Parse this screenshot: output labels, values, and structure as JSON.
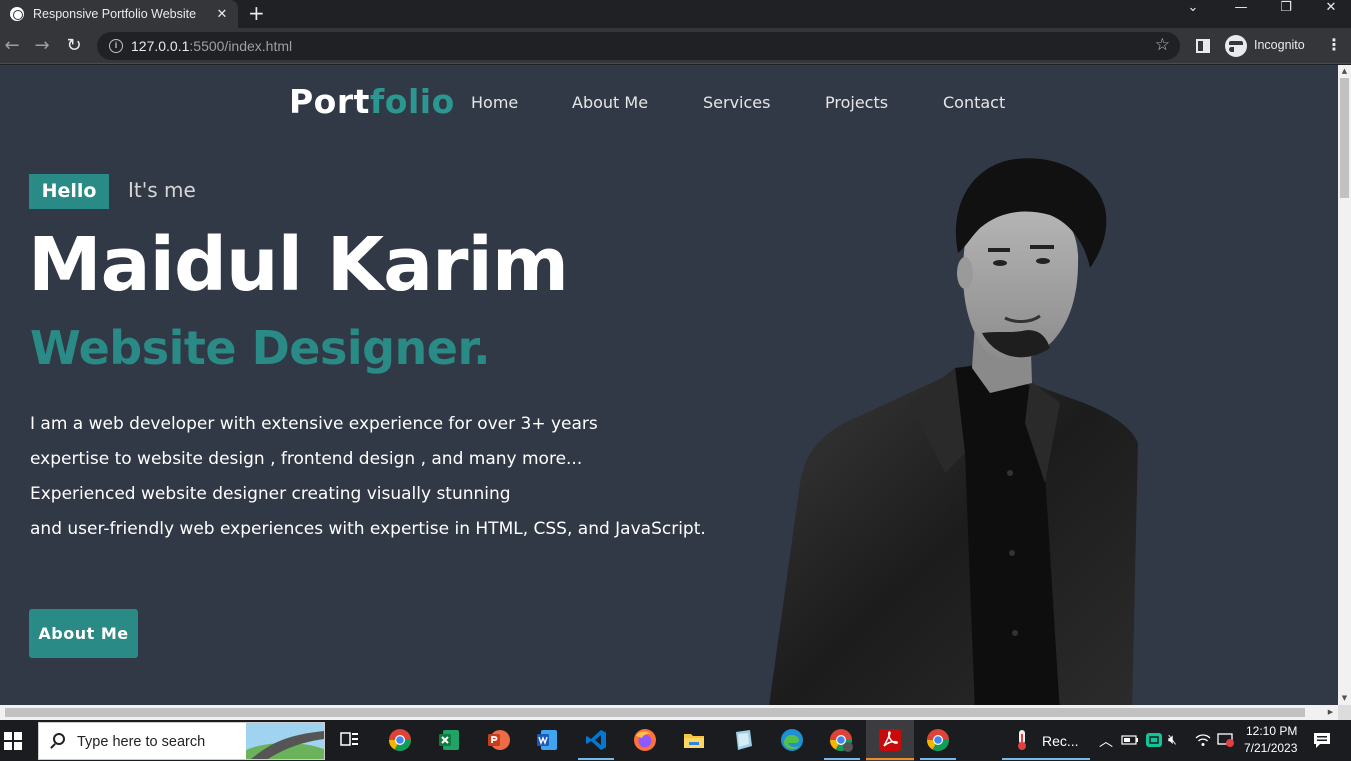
{
  "browser": {
    "tab_title": "Responsive Portfolio Website",
    "tab_close": "✕",
    "new_tab": "+",
    "url_host": "127.0.0.1",
    "url_rest": ":5500/index.html",
    "profile_label": "Incognito",
    "window_controls": {
      "dropdown": "⌄",
      "minimize": "—",
      "restore": "❐",
      "close": "✕"
    }
  },
  "page": {
    "logo_main": "Port",
    "logo_accent": "folio",
    "nav": [
      "Home",
      "About Me",
      "Services",
      "Projects",
      "Contact"
    ],
    "hello_badge": "Hello",
    "intro": "It's me",
    "name": "Maidul Karim",
    "role": "Website Designer.",
    "description": [
      "I am a web developer with extensive experience for over 3+ years",
      "expertise to website design , frontend design , and many more...",
      "Experienced website designer creating visually stunning",
      "and user-friendly web experiences with expertise in HTML, CSS, and JavaScript."
    ],
    "cta_label": "About Me",
    "colors": {
      "background": "#323946",
      "accent": "#2a8a86",
      "text": "#ffffff"
    }
  },
  "taskbar": {
    "search_placeholder": "Type here to search",
    "running_label": "Rec...",
    "time": "12:10 PM",
    "date": "7/21/2023",
    "apps": [
      "task-view-icon",
      "chrome-icon",
      "excel-icon",
      "powerpoint-icon",
      "word-icon",
      "vscode-icon",
      "firefox-icon",
      "file-explorer-icon",
      "notes-icon",
      "edge-icon",
      "chrome-profile-icon",
      "acrobat-icon",
      "chrome-icon",
      "recorder-icon"
    ]
  }
}
